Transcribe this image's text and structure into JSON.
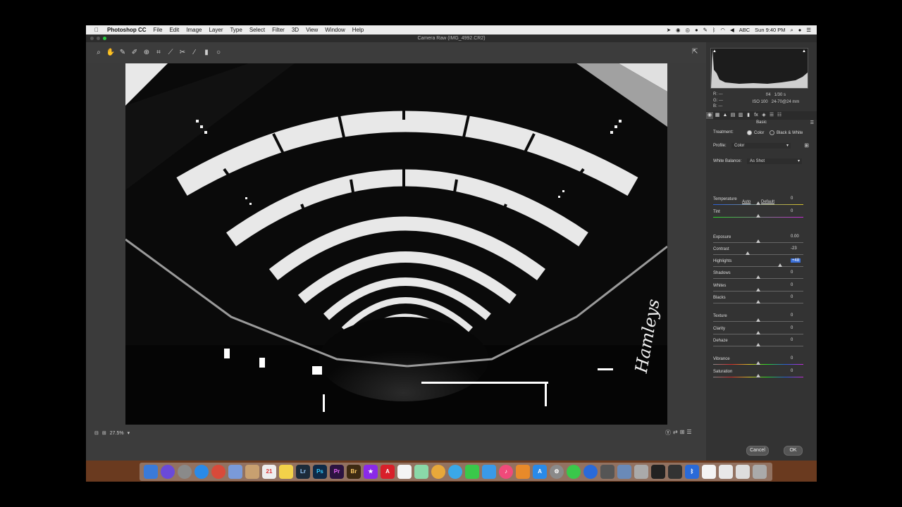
{
  "menubar": {
    "app_name": "Photoshop CC",
    "items": [
      "File",
      "Edit",
      "Image",
      "Layer",
      "Type",
      "Select",
      "Filter",
      "3D",
      "View",
      "Window",
      "Help"
    ],
    "clock": "Sun 9:40 PM",
    "input_source": "ABC"
  },
  "window": {
    "title": "Camera Raw (IMG_4992.CR2)"
  },
  "toolbar": {
    "tools": [
      "zoom-tool-icon",
      "hand-tool-icon",
      "white-balance-tool-icon",
      "color-sampler-tool-icon",
      "targeted-adjustment-tool-icon",
      "crop-tool-icon",
      "straighten-tool-icon",
      "spot-removal-tool-icon",
      "adjustment-brush-icon",
      "graduated-filter-icon",
      "radial-filter-icon"
    ]
  },
  "status": {
    "zoom": "27.5%"
  },
  "info": {
    "r": "R:   ---",
    "g": "G:   ---",
    "b": "B:   ---",
    "aperture": "f/4",
    "shutter": "1/30 s",
    "iso": "ISO 100",
    "lens": "24-70@24 mm"
  },
  "panel": {
    "title": "Basic",
    "treatment_label": "Treatment:",
    "treatment_color": "Color",
    "treatment_bw": "Black & White",
    "profile_label": "Profile:",
    "profile_value": "Color",
    "wb_label": "White Balance:",
    "wb_value": "As Shot",
    "auto": "Auto",
    "default": "Default",
    "sliders": [
      {
        "label": "Temperature",
        "value": "0",
        "pos": 0.5
      },
      {
        "label": "Tint",
        "value": "0",
        "pos": 0.5
      },
      {
        "label": "Exposure",
        "value": "0.00",
        "pos": 0.5
      },
      {
        "label": "Contrast",
        "value": "-23",
        "pos": 0.385
      },
      {
        "label": "Highlights",
        "value": "+48",
        "pos": 0.74
      },
      {
        "label": "Shadows",
        "value": "0",
        "pos": 0.5
      },
      {
        "label": "Whites",
        "value": "0",
        "pos": 0.5
      },
      {
        "label": "Blacks",
        "value": "0",
        "pos": 0.5
      },
      {
        "label": "Texture",
        "value": "0",
        "pos": 0.5
      },
      {
        "label": "Clarity",
        "value": "0",
        "pos": 0.5
      },
      {
        "label": "Dehaze",
        "value": "0",
        "pos": 0.5
      },
      {
        "label": "Vibrance",
        "value": "0",
        "pos": 0.5
      },
      {
        "label": "Saturation",
        "value": "0",
        "pos": 0.5
      }
    ]
  },
  "buttons": {
    "cancel": "Cancel",
    "ok": "OK"
  },
  "dock": {
    "apps": [
      {
        "name": "Lr",
        "color": "#1c2b3a"
      },
      {
        "name": "Ps",
        "color": "#0f2a47"
      },
      {
        "name": "Pr",
        "color": "#2b1340"
      },
      {
        "name": "Br",
        "color": "#3d2a12"
      }
    ]
  }
}
